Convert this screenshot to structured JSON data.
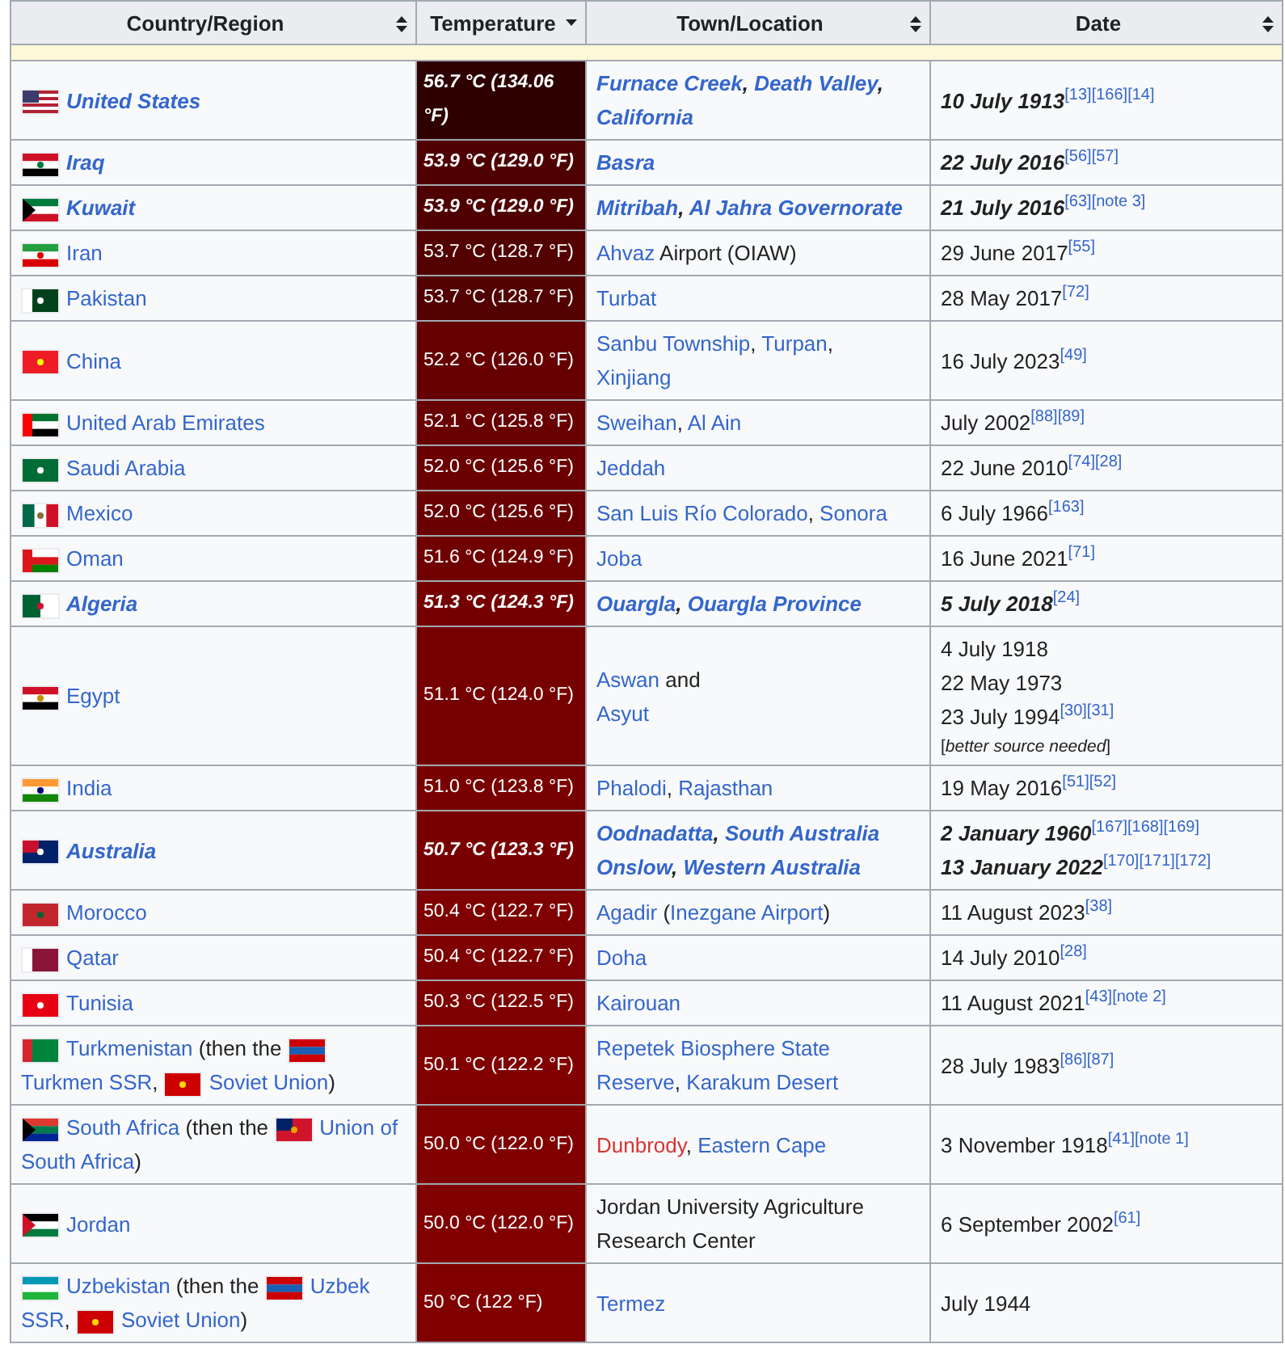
{
  "table": {
    "columns": [
      {
        "label": "Country/Region",
        "sorted": false
      },
      {
        "label": "Temperature",
        "sorted": true
      },
      {
        "label": "Town/Location",
        "sorted": false
      },
      {
        "label": "Date",
        "sorted": false
      }
    ],
    "rows": [
      {
        "record": true,
        "country": [
          {
            "kind": "flag"
          },
          {
            "kind": "link",
            "text": "United States"
          }
        ],
        "temperature": {
          "text": "56.7 °C (134.06 °F)",
          "color": "#2e0000"
        },
        "location": [
          [
            {
              "kind": "link",
              "text": "Furnace Creek"
            },
            {
              "kind": "text",
              "text": ", "
            },
            {
              "kind": "link",
              "text": "Death Valley"
            },
            {
              "kind": "text",
              "text": ","
            }
          ],
          [
            {
              "kind": "link",
              "text": "California"
            }
          ]
        ],
        "dates": [
          {
            "text": "10 July 1913",
            "refs": [
              "[13]",
              "[166]",
              "[14]"
            ]
          }
        ]
      },
      {
        "record": true,
        "country": [
          {
            "kind": "flag"
          },
          {
            "kind": "link",
            "text": "Iraq"
          }
        ],
        "temperature": {
          "text": "53.9 °C (129.0 °F)",
          "color": "#4f0000"
        },
        "location": [
          [
            {
              "kind": "link",
              "text": "Basra"
            }
          ]
        ],
        "dates": [
          {
            "text": "22 July 2016",
            "refs": [
              "[56]",
              "[57]"
            ]
          }
        ]
      },
      {
        "record": true,
        "country": [
          {
            "kind": "flag"
          },
          {
            "kind": "link",
            "text": "Kuwait"
          }
        ],
        "temperature": {
          "text": "53.9 °C (129.0 °F)",
          "color": "#4f0000"
        },
        "location": [
          [
            {
              "kind": "link",
              "text": "Mitribah"
            },
            {
              "kind": "text",
              "text": ", "
            },
            {
              "kind": "link",
              "text": "Al Jahra Governorate"
            }
          ]
        ],
        "dates": [
          {
            "text": "21 July 2016",
            "refs": [
              "[63]",
              "[note 3]"
            ]
          }
        ]
      },
      {
        "record": false,
        "country": [
          {
            "kind": "flag"
          },
          {
            "kind": "link",
            "text": "Iran"
          }
        ],
        "temperature": {
          "text": "53.7 °C (128.7 °F)",
          "color": "#520000"
        },
        "location": [
          [
            {
              "kind": "link",
              "text": "Ahvaz"
            },
            {
              "kind": "text",
              "text": " Airport (OIAW)"
            }
          ]
        ],
        "dates": [
          {
            "text": "29 June 2017",
            "refs": [
              "[55]"
            ]
          }
        ]
      },
      {
        "record": false,
        "country": [
          {
            "kind": "flag"
          },
          {
            "kind": "link",
            "text": "Pakistan"
          }
        ],
        "temperature": {
          "text": "53.7 °C (128.7 °F)",
          "color": "#520000"
        },
        "location": [
          [
            {
              "kind": "link",
              "text": "Turbat"
            }
          ]
        ],
        "dates": [
          {
            "text": "28 May 2017",
            "refs": [
              "[72]"
            ]
          }
        ]
      },
      {
        "record": false,
        "country": [
          {
            "kind": "flag"
          },
          {
            "kind": "link",
            "text": "China"
          }
        ],
        "temperature": {
          "text": "52.2 °C (126.0 °F)",
          "color": "#660000"
        },
        "location": [
          [
            {
              "kind": "link",
              "text": "Sanbu Township"
            },
            {
              "kind": "text",
              "text": ", "
            },
            {
              "kind": "link",
              "text": "Turpan"
            },
            {
              "kind": "text",
              "text": ","
            }
          ],
          [
            {
              "kind": "link",
              "text": "Xinjiang"
            }
          ]
        ],
        "dates": [
          {
            "text": "16 July 2023",
            "refs": [
              "[49]"
            ]
          }
        ]
      },
      {
        "record": false,
        "country": [
          {
            "kind": "flag"
          },
          {
            "kind": "link",
            "text": "United Arab Emirates"
          }
        ],
        "temperature": {
          "text": "52.1 °C (125.8 °F)",
          "color": "#680000"
        },
        "location": [
          [
            {
              "kind": "link",
              "text": "Sweihan"
            },
            {
              "kind": "text",
              "text": ", "
            },
            {
              "kind": "link",
              "text": "Al Ain"
            }
          ]
        ],
        "dates": [
          {
            "text": "July 2002",
            "refs": [
              "[88]",
              "[89]"
            ]
          }
        ]
      },
      {
        "record": false,
        "country": [
          {
            "kind": "flag"
          },
          {
            "kind": "link",
            "text": "Saudi Arabia"
          }
        ],
        "temperature": {
          "text": "52.0 °C (125.6 °F)",
          "color": "#6a0000"
        },
        "location": [
          [
            {
              "kind": "link",
              "text": "Jeddah"
            }
          ]
        ],
        "dates": [
          {
            "text": "22 June 2010",
            "refs": [
              "[74]",
              "[28]"
            ]
          }
        ]
      },
      {
        "record": false,
        "country": [
          {
            "kind": "flag"
          },
          {
            "kind": "link",
            "text": "Mexico"
          }
        ],
        "temperature": {
          "text": "52.0 °C (125.6 °F)",
          "color": "#6a0000"
        },
        "location": [
          [
            {
              "kind": "link",
              "text": "San Luis Río Colorado"
            },
            {
              "kind": "text",
              "text": ", "
            },
            {
              "kind": "link",
              "text": "Sonora"
            }
          ]
        ],
        "dates": [
          {
            "text": "6 July 1966",
            "refs": [
              "[163]"
            ]
          }
        ]
      },
      {
        "record": false,
        "country": [
          {
            "kind": "flag"
          },
          {
            "kind": "link",
            "text": "Oman"
          }
        ],
        "temperature": {
          "text": "51.6 °C (124.9 °F)",
          "color": "#700000"
        },
        "location": [
          [
            {
              "kind": "link",
              "text": "Joba"
            }
          ]
        ],
        "dates": [
          {
            "text": "16 June 2021",
            "refs": [
              "[71]"
            ]
          }
        ]
      },
      {
        "record": true,
        "country": [
          {
            "kind": "flag"
          },
          {
            "kind": "link",
            "text": "Algeria"
          }
        ],
        "temperature": {
          "text": "51.3 °C (124.3 °F)",
          "color": "#740000"
        },
        "location": [
          [
            {
              "kind": "link",
              "text": "Ouargla"
            },
            {
              "kind": "text",
              "text": ", "
            },
            {
              "kind": "link",
              "text": "Ouargla Province"
            }
          ]
        ],
        "dates": [
          {
            "text": "5 July 2018",
            "refs": [
              "[24]"
            ]
          }
        ]
      },
      {
        "record": false,
        "country": [
          {
            "kind": "flag"
          },
          {
            "kind": "link",
            "text": "Egypt"
          }
        ],
        "temperature": {
          "text": "51.1 °C (124.0 °F)",
          "color": "#760000"
        },
        "location": [
          [
            {
              "kind": "link",
              "text": "Aswan"
            },
            {
              "kind": "text",
              "text": " and"
            }
          ],
          [
            {
              "kind": "link",
              "text": "Asyut"
            }
          ]
        ],
        "dates": [
          {
            "text": "4 July 1918"
          },
          {
            "text": "22 May 1973"
          },
          {
            "text": "23 July 1994",
            "refs": [
              "[30]",
              "[31]"
            ]
          }
        ],
        "note": "[*better source needed*]"
      },
      {
        "record": false,
        "country": [
          {
            "kind": "flag"
          },
          {
            "kind": "link",
            "text": "India"
          }
        ],
        "temperature": {
          "text": "51.0 °C (123.8 °F)",
          "color": "#780000"
        },
        "location": [
          [
            {
              "kind": "link",
              "text": "Phalodi"
            },
            {
              "kind": "text",
              "text": ", "
            },
            {
              "kind": "link",
              "text": "Rajasthan"
            }
          ]
        ],
        "dates": [
          {
            "text": "19 May 2016",
            "refs": [
              "[51]",
              "[52]"
            ]
          }
        ]
      },
      {
        "record": true,
        "country": [
          {
            "kind": "flag"
          },
          {
            "kind": "link",
            "text": "Australia"
          }
        ],
        "temperature": {
          "text": "50.7 °C (123.3 °F)",
          "color": "#7a0000"
        },
        "location": [
          [
            {
              "kind": "link",
              "text": "Oodnadatta"
            },
            {
              "kind": "text",
              "text": ", "
            },
            {
              "kind": "link",
              "text": "South Australia"
            }
          ],
          [
            {
              "kind": "link",
              "text": "Onslow"
            },
            {
              "kind": "text",
              "text": ", "
            },
            {
              "kind": "link",
              "text": "Western Australia"
            }
          ]
        ],
        "dates": [
          {
            "text": "2 January 1960",
            "refs": [
              "[167]",
              "[168]",
              "[169]"
            ]
          },
          {
            "text": "13 January 2022",
            "refs": [
              "[170]",
              "[171]",
              "[172]"
            ]
          }
        ]
      },
      {
        "record": false,
        "country": [
          {
            "kind": "flag"
          },
          {
            "kind": "link",
            "text": "Morocco"
          }
        ],
        "temperature": {
          "text": "50.4 °C (122.7 °F)",
          "color": "#7e0000"
        },
        "location": [
          [
            {
              "kind": "link",
              "text": "Agadir"
            },
            {
              "kind": "text",
              "text": " ("
            },
            {
              "kind": "link",
              "text": "Inezgane Airport"
            },
            {
              "kind": "text",
              "text": ")"
            }
          ]
        ],
        "dates": [
          {
            "text": "11 August 2023",
            "refs": [
              "[38]"
            ]
          }
        ]
      },
      {
        "record": false,
        "country": [
          {
            "kind": "flag"
          },
          {
            "kind": "link",
            "text": "Qatar"
          }
        ],
        "temperature": {
          "text": "50.4 °C (122.7 °F)",
          "color": "#7e0000"
        },
        "location": [
          [
            {
              "kind": "link",
              "text": "Doha"
            }
          ]
        ],
        "dates": [
          {
            "text": "14 July 2010",
            "refs": [
              "[28]"
            ]
          }
        ]
      },
      {
        "record": false,
        "country": [
          {
            "kind": "flag"
          },
          {
            "kind": "link",
            "text": "Tunisia"
          }
        ],
        "temperature": {
          "text": "50.3 °C (122.5 °F)",
          "color": "#7e0000"
        },
        "location": [
          [
            {
              "kind": "link",
              "text": "Kairouan"
            }
          ]
        ],
        "dates": [
          {
            "text": "11 August 2021",
            "refs": [
              "[43]",
              "[note 2]"
            ]
          }
        ]
      },
      {
        "record": false,
        "country": [
          [
            {
              "kind": "flag"
            },
            {
              "kind": "link",
              "text": "Turkmenistan"
            },
            {
              "kind": "text",
              "text": " (then the "
            },
            {
              "kind": "flag"
            }
          ],
          [
            {
              "kind": "link",
              "text": "Turkmen SSR"
            },
            {
              "kind": "text",
              "text": ", "
            },
            {
              "kind": "flag"
            },
            {
              "kind": "link",
              "text": "Soviet Union"
            },
            {
              "kind": "text",
              "text": ")"
            }
          ]
        ],
        "temperature": {
          "text": "50.1 °C (122.2 °F)",
          "color": "#800000"
        },
        "location": [
          [
            {
              "kind": "link",
              "text": "Repetek Biosphere State"
            }
          ],
          [
            {
              "kind": "link",
              "text": "Reserve"
            },
            {
              "kind": "text",
              "text": ", "
            },
            {
              "kind": "link",
              "text": "Karakum Desert"
            }
          ]
        ],
        "dates": [
          {
            "text": "28 July 1983",
            "refs": [
              "[86]",
              "[87]"
            ]
          }
        ]
      },
      {
        "record": false,
        "country": [
          [
            {
              "kind": "flag"
            },
            {
              "kind": "link",
              "text": "South Africa"
            },
            {
              "kind": "text",
              "text": " (then the "
            },
            {
              "kind": "flag"
            },
            {
              "kind": "link",
              "text": "Union of"
            }
          ],
          [
            {
              "kind": "link",
              "text": "South Africa"
            },
            {
              "kind": "text",
              "text": ")"
            }
          ]
        ],
        "temperature": {
          "text": "50.0 °C (122.0 °F)",
          "color": "#800000"
        },
        "location": [
          [
            {
              "kind": "redlink",
              "text": "Dunbrody"
            },
            {
              "kind": "text",
              "text": ", "
            },
            {
              "kind": "link",
              "text": "Eastern Cape"
            }
          ]
        ],
        "dates": [
          {
            "text": "3 November 1918",
            "refs": [
              "[41]",
              "[note 1]"
            ]
          }
        ]
      },
      {
        "record": false,
        "country": [
          {
            "kind": "flag"
          },
          {
            "kind": "link",
            "text": "Jordan"
          }
        ],
        "temperature": {
          "text": "50.0 °C (122.0 °F)",
          "color": "#800000"
        },
        "location": [
          [
            {
              "kind": "text",
              "text": "Jordan University Agriculture"
            }
          ],
          [
            {
              "kind": "text",
              "text": "Research Center"
            }
          ]
        ],
        "dates": [
          {
            "text": "6 September 2002",
            "refs": [
              "[61]"
            ]
          }
        ]
      },
      {
        "record": false,
        "country": [
          [
            {
              "kind": "flag"
            },
            {
              "kind": "link",
              "text": "Uzbekistan"
            },
            {
              "kind": "text",
              "text": " (then the "
            },
            {
              "kind": "flag"
            },
            {
              "kind": "link",
              "text": "Uzbek"
            }
          ],
          [
            {
              "kind": "link",
              "text": "SSR"
            },
            {
              "kind": "text",
              "text": ", "
            },
            {
              "kind": "flag"
            },
            {
              "kind": "link",
              "text": "Soviet Union"
            },
            {
              "kind": "text",
              "text": ")"
            }
          ]
        ],
        "temperature": {
          "text": "50 °C (122 °F)",
          "color": "#800000"
        },
        "location": [
          [
            {
              "kind": "link",
              "text": "Termez"
            }
          ]
        ],
        "dates": [
          {
            "text": "July 1944"
          }
        ]
      }
    ]
  }
}
